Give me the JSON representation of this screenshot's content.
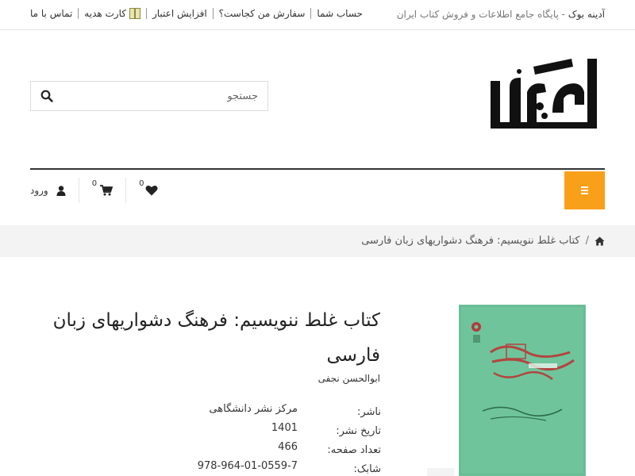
{
  "header": {
    "brand": "آدینه بوک",
    "tagline": " - پایگاه جامع اطلاعات و فروش کتاب ایران",
    "nav": {
      "account": "حساب شما",
      "order_location": "سفارش من کجاست؟",
      "add_credit": "افزایش اعتبار",
      "gift_card": "کارت هدیه",
      "contact": "تماس با ما"
    }
  },
  "search": {
    "placeholder": "جستجو"
  },
  "navbar": {
    "favorites_count": "0",
    "cart_count": "0",
    "login_label": "ورود"
  },
  "breadcrumb": {
    "current": "کتاب غلط ننویسیم: فرهنگ دشواریهای زبان فارسی"
  },
  "product": {
    "title": "کتاب غلط ننویسیم: فرهنگ دشواریهای زبان فارسی",
    "author": "ابوالحسن نجفی",
    "details": [
      {
        "label": "ناشر:",
        "value": "مرکز نشر دانشگاهی"
      },
      {
        "label": "تاریخ نشر:",
        "value": "1401"
      },
      {
        "label": "تعداد صفحه:",
        "value": "466"
      },
      {
        "label": "شابک:",
        "value": "978-964-01-0559-7"
      }
    ]
  },
  "colors": {
    "accent": "#f9a01b",
    "cover_green": "#6fc49c",
    "breadcrumb_bg": "#f3f3f3"
  },
  "icons": [
    "gift-card-icon",
    "search-icon",
    "heart-icon",
    "cart-icon",
    "user-icon",
    "menu-icon",
    "home-icon"
  ]
}
